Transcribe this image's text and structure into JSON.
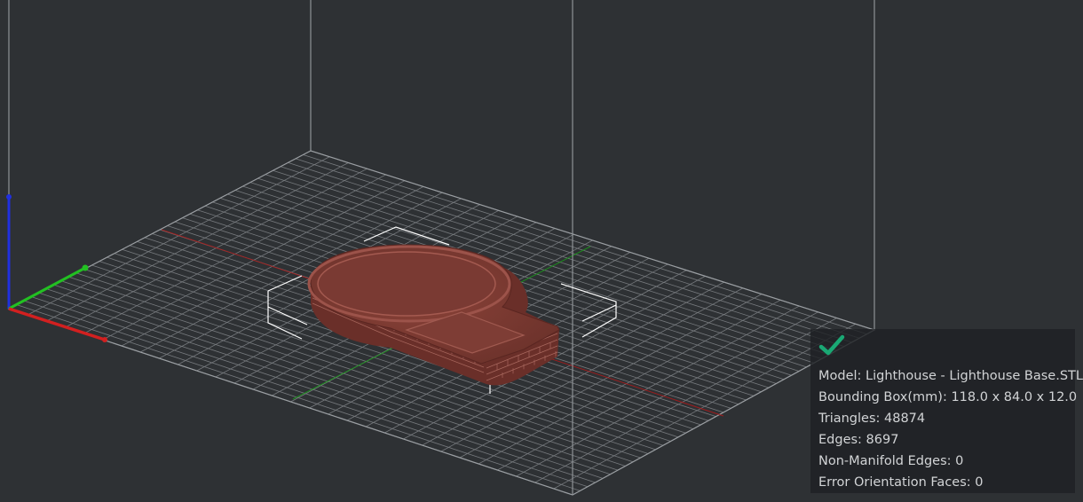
{
  "scene": {
    "description_icon": "3d-build-volume",
    "colors": {
      "background": "#2e3134",
      "grid": "#8e9296",
      "frame": "#8e9296",
      "axis_x": "#d22020",
      "axis_y": "#22c022",
      "axis_z": "#2030e0",
      "model": "#7e3c34",
      "selection_box": "#ffffff"
    }
  },
  "info_panel": {
    "status_icon": "checkmark-icon",
    "status_color": "#1aa874",
    "model": "Model: Lighthouse - Lighthouse Base.STL",
    "bounding_box": "Bounding Box(mm): 118.0 x 84.0 x 12.0",
    "triangles": "Triangles: 48874",
    "edges": "Edges: 8697",
    "non_manifold_edges": "Non-Manifold Edges: 0",
    "error_orientation_faces": "Error Orientation Faces: 0"
  }
}
